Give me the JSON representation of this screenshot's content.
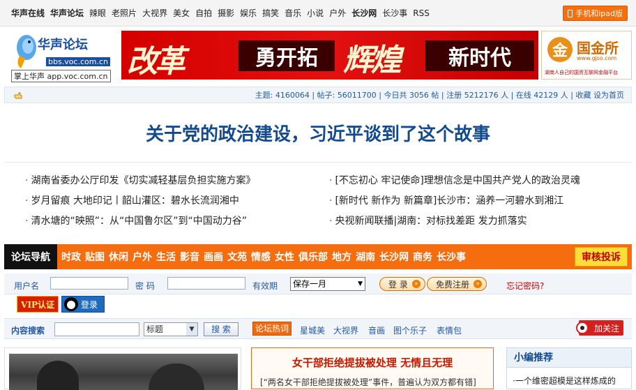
{
  "topnav": {
    "items": [
      "华声在线",
      "华声论坛",
      "辣眼",
      "老照片",
      "大视界",
      "美女",
      "自拍",
      "摄影",
      "娱乐",
      "搞笑",
      "音乐",
      "小说",
      "户外",
      "长沙网",
      "长沙事",
      "RSS"
    ],
    "bold": [
      true,
      true,
      false,
      false,
      false,
      false,
      false,
      false,
      false,
      false,
      false,
      false,
      false,
      true,
      false,
      false
    ],
    "mobile_label": "手机和ipad版"
  },
  "logo": {
    "title": "华声论坛",
    "url1": "bbs.voc.com.cn",
    "url2": "掌上华声 app.voc.com.cn"
  },
  "banner": {
    "word1": "改革",
    "box1": "勇开拓",
    "word2": "辉煌",
    "box2": "新时代"
  },
  "ad": {
    "mark": "金",
    "name": "国金所",
    "domain": "www.gjso.com",
    "tagline": "湖南人自己的国资互联网金融平台"
  },
  "stats": {
    "text": "主题: 4160064 | 帖子: 56011700 | 今日共 3056 帖 | 注册 5212176 人 | 在线 42129 人 | 收藏 设为首页"
  },
  "headline": "关于党的政治建设，习近平谈到了这个故事",
  "news": {
    "left": [
      "湖南省委办公厅印发《切实减轻基层负担实施方案》",
      "岁月留痕 大地印记丨韶山灌区：碧水长流润湘中",
      "清水塘的“映照”：从“中国鲁尔区”到“中国动力谷”"
    ],
    "right": [
      "[不忘初心 牢记使命]理想信念是中国共产党人的政治灵魂",
      "[新时代 新作为 新篇章]长沙市：涵养一河碧水到湘江",
      "央视新闻联播|湖南：对标找差距 发力抓落实"
    ]
  },
  "forumnav": {
    "label": "论坛导航",
    "items": [
      "时政",
      "贴图",
      "休闲",
      "户外",
      "生活",
      "影音",
      "画画",
      "文苑",
      "情感",
      "女性",
      "俱乐部",
      "地方",
      "湖南",
      "长沙网",
      "商务",
      "长沙事"
    ],
    "audit": "审核投诉"
  },
  "login": {
    "username_label": "用户名",
    "password_label": "密  码",
    "validity_label": "有效期",
    "validity_value": "保存一月",
    "login_btn": "登 录",
    "register_btn": "免费注册",
    "forgot": "忘记密码?",
    "vip": "VIP认证",
    "qq": "登录"
  },
  "search": {
    "label": "内容搜索",
    "type_value": "标题",
    "btn": "搜 索",
    "hot_label": "论坛热词",
    "hot_words": [
      "星城美",
      "大视界",
      "音画",
      "图个乐子",
      "表情包"
    ],
    "weibo": "加关注"
  },
  "feature": {
    "title": "女干部拒绝提拔被处理 无情且无理",
    "desc": "[“两名女干部拒绝提拔被处理”事件，普遍认为双方都有错]"
  },
  "recommend": {
    "header": "小编推荐",
    "item": "一个维密超模是这样炼成的"
  }
}
